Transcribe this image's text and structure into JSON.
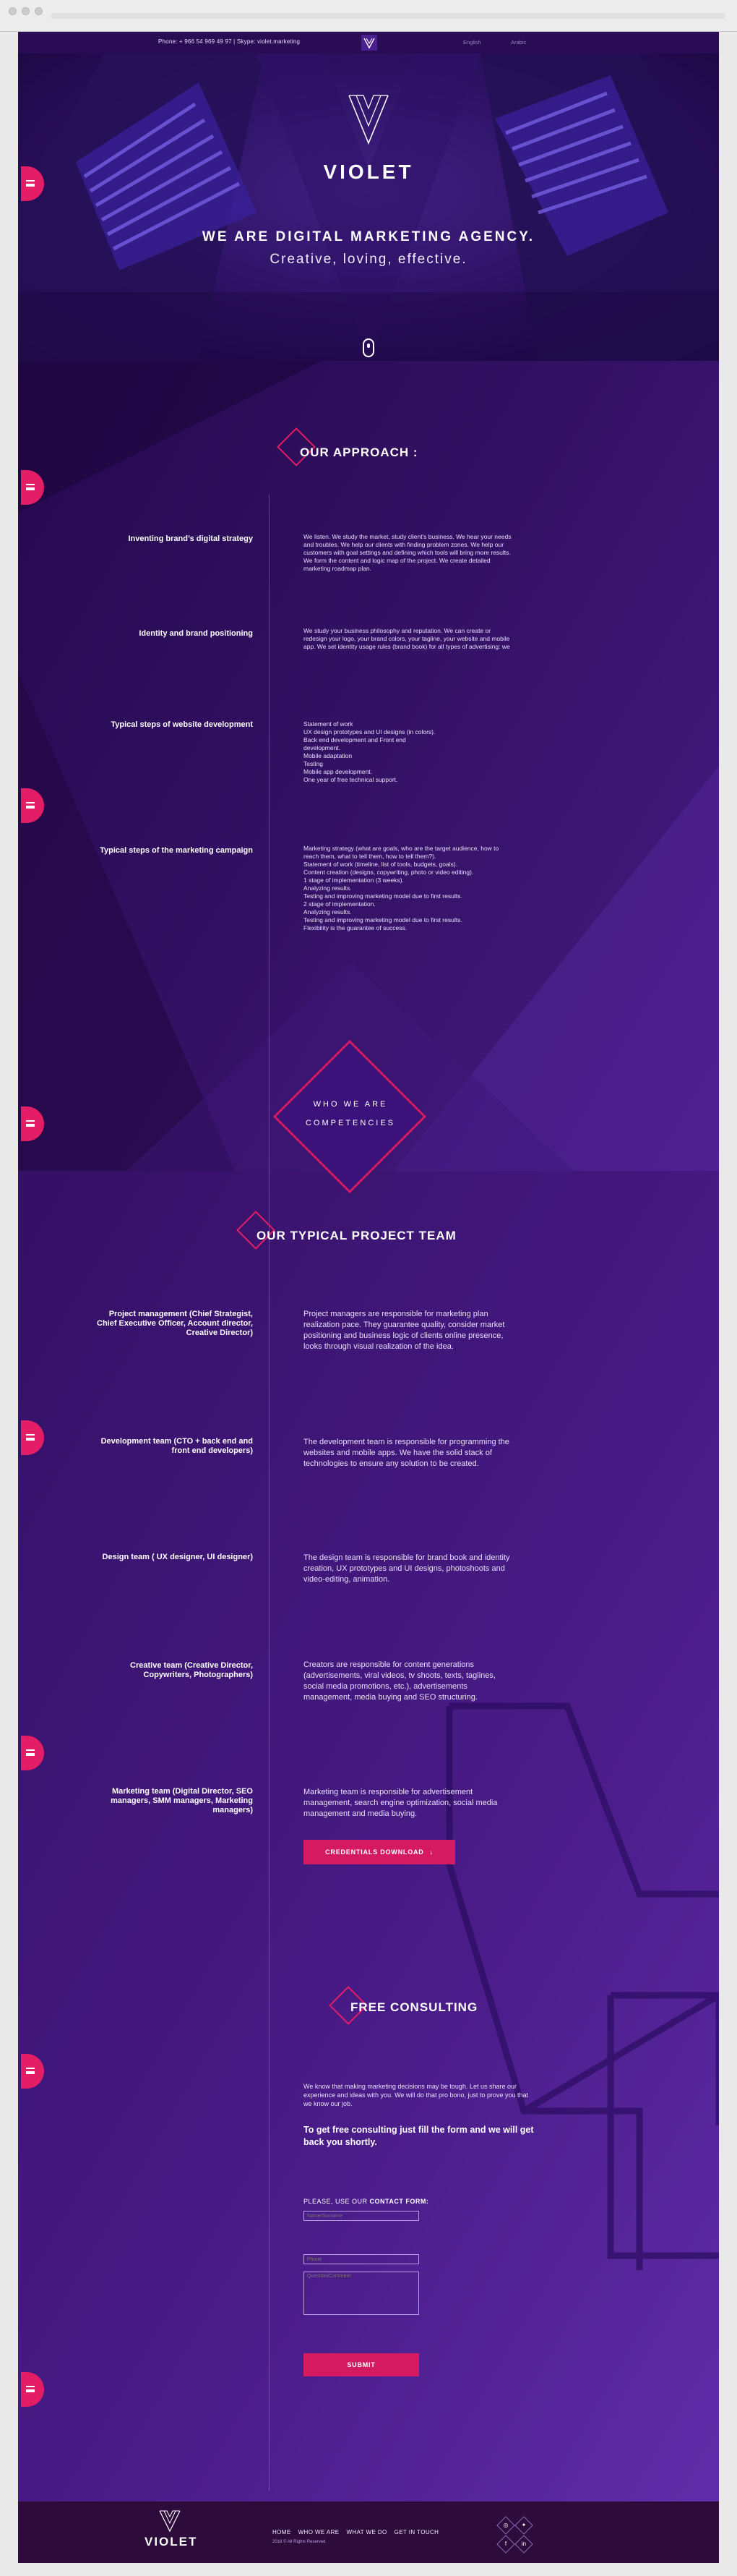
{
  "topbar": {
    "contact": "Phone: + 966 54 969 49 97  |  Skype: violet.marketing",
    "lang_en": "English",
    "lang_ar": "Arabic"
  },
  "hero": {
    "brand": "VIOLET",
    "title": "WE ARE DIGITAL MARKETING AGENCY.",
    "subtitle": "Creative, loving, effective."
  },
  "approach": {
    "title": "OUR APPROACH :",
    "rows": [
      {
        "label": "Inventing brand’s digital strategy",
        "text": "We listen. We study the market, study client's business. We hear your needs and troubles. We help our clients with finding problem zones. We help our customers with goal settings and defining which tools will bring more results. We form the content and logic map of the project. We create detailed marketing roadmap plan."
      },
      {
        "label": "Identity and brand positioning",
        "text": "We study your business philosophy and reputation. We can create or redesign your logo, your brand colors, your tagline, your website and mobile app. We set identity usage rules (brand book) for all types of advertising: we create the"
      },
      {
        "label": "Typical steps of website development",
        "items": [
          "Statement of work",
          "UX design prototypes and UI designs (in colors).",
          "Back end development and Front end",
          "development.",
          "Mobile adaptation",
          "Testing",
          "Mobile app development.",
          "One year of free technical support."
        ]
      },
      {
        "label": "Typical steps of the marketing campaign",
        "items": [
          "Marketing strategy (what are goals, who are the target audience, how to",
          "reach them, what to tell them, how to tell them?).",
          "Statement of work (timeline, list of tools, budgets, goals).",
          "Content creation (designs, copywriting, photo or video editing).",
          "1 stage of implementation (3 weeks).",
          "Analyzing results.",
          "Testing and improving marketing model due to first results.",
          "2 stage of implementation.",
          "Analyzing results.",
          "Testing and improving marketing model due to first results.",
          "Flexibility is the guarantee of success."
        ]
      }
    ]
  },
  "who_we_are": {
    "line1": "WHO WE ARE",
    "line2": "COMPETENCIES"
  },
  "team": {
    "title": "OUR TYPICAL PROJECT TEAM",
    "rows": [
      {
        "label": "Project management (Chief Strategist, Chief Executive Officer, Account director, Creative Director)",
        "text": "Project managers are responsible for marketing plan realization pace. They guarantee quality, consider market positioning and business logic of clients online presence, looks through visual realization of the idea."
      },
      {
        "label": "Development team (CTO + back end and front end developers)",
        "text": "The development team is responsible for programming the websites and mobile apps. We have the solid stack of technologies to ensure any solution to be created."
      },
      {
        "label": "Design team ( UX designer, UI designer)",
        "text": "The design team is responsible for brand book and identity creation, UX prototypes and UI designs, photoshoots and video-editing, animation."
      },
      {
        "label": "Creative team (Creative Director, Copywriters, Photographers)",
        "text": "Creators are responsible for content generations (advertisements, viral videos, tv shoots, texts, taglines, social media promotions, etc.), advertisements management, media buying and SEO structuring."
      },
      {
        "label": "Marketing team (Digital Director, SEO managers, SMM managers, Marketing managers)",
        "text": "Marketing team is responsible for advertisement management, search engine optimization, social media management and media buying."
      }
    ],
    "cta": "CREDENTIALS DOWNLOAD"
  },
  "consulting": {
    "title": "FREE CONSULTING",
    "intro": "We know that making marketing decisions may be tough. Let us share our experience and ideas with you. We will do that pro bono, just to prove you that we know our job.",
    "headline": "To get free consulting just fill the form and we will get back you shortly.",
    "form_label_prefix": "PLEASE, USE OUR ",
    "form_label_bold": "CONTACT FORM:",
    "name_placeholder": "Name/Surname",
    "phone_placeholder": "Phone",
    "message_placeholder": "Question/Comment",
    "submit": "SUBMIT"
  },
  "footer": {
    "brand": "VIOLET",
    "nav": [
      "HOME",
      "WHO WE ARE",
      "WHAT WE DO",
      "GET IN TOUCH"
    ],
    "copyright": "2016 © All Rights Reserved",
    "social": [
      "instagram-icon",
      "twitter-icon",
      "facebook-icon",
      "linkedin-icon"
    ]
  },
  "colors": {
    "accent": "#e31d66",
    "deep_purple": "#2a0c55",
    "violet": "#6a35b8",
    "footer": "#2d0b3b"
  }
}
